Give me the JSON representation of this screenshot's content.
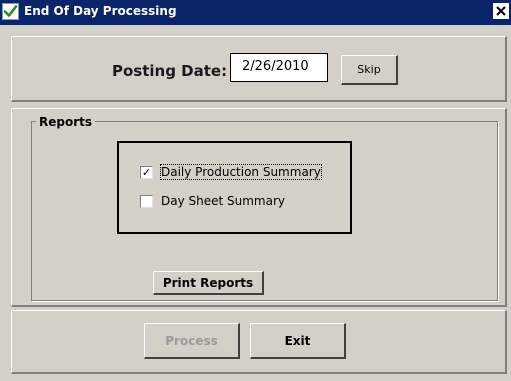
{
  "window": {
    "title": "End Of Day Processing",
    "title_checkbox_glyph": "✔",
    "close_glyph": "✕",
    "title_bar_color": "#0a246a",
    "background_color": "#d4d0c8"
  },
  "posting": {
    "label": "Posting Date:",
    "date_value": "2/26/2010",
    "skip_label": "Skip"
  },
  "reports": {
    "group_label": "Reports",
    "items": [
      {
        "label": "Daily Production Summary",
        "checked": true,
        "check_glyph": "✓"
      },
      {
        "label": "Day Sheet Summary",
        "checked": false,
        "check_glyph": ""
      }
    ],
    "print_label": "Print Reports"
  },
  "actions": {
    "process_label": "Process",
    "process_enabled": false,
    "exit_label": "Exit"
  },
  "icons": {
    "title_check": "checkbox-checked-icon",
    "close": "close-icon"
  }
}
